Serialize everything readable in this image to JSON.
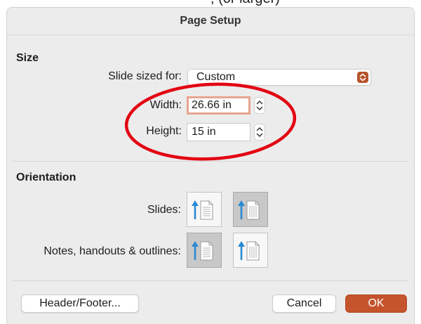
{
  "window": {
    "title": "Page Setup"
  },
  "size": {
    "heading": "Size",
    "slide_sized_for": {
      "label": "Slide sized for:",
      "value": "Custom"
    },
    "width": {
      "label": "Width:",
      "value": "26.66 in"
    },
    "height": {
      "label": "Height:",
      "value": "15 in"
    }
  },
  "orientation": {
    "heading": "Orientation",
    "slides": {
      "label": "Slides:",
      "selected": "landscape"
    },
    "notes": {
      "label": "Notes, handouts & outlines:",
      "selected": "portrait"
    }
  },
  "footer": {
    "header_footer_label": "Header/Footer...",
    "cancel_label": "Cancel",
    "ok_label": "OK"
  },
  "colors": {
    "accent": "#c5532b",
    "focus_ring": "#e7a58f",
    "annotation": "#e30613",
    "icon_arrow": "#2a8ad4"
  },
  "cutoff_text": ", (or larger) "
}
